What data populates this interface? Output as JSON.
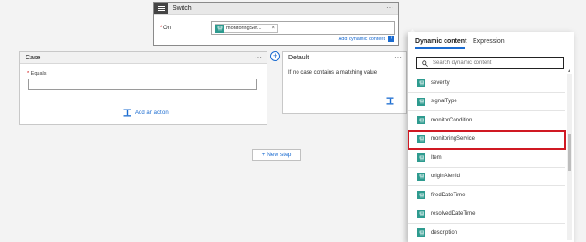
{
  "switch": {
    "title": "Switch",
    "menu": "···",
    "on_label": "On",
    "required_mark": "*",
    "token_label": "monitoringSer...",
    "token_remove": "×",
    "add_dynamic_label": "Add dynamic content",
    "add_dynamic_plus": "+"
  },
  "case": {
    "title": "Case",
    "menu": "···",
    "equals_label": "Equals",
    "required_mark": "*",
    "equals_value": "",
    "add_action_label": "Add an action"
  },
  "add_case": "+",
  "default": {
    "title": "Default",
    "menu": "···",
    "text": "If no case contains a matching value"
  },
  "new_step_label": "+ New step",
  "dynamic_panel": {
    "tabs": [
      "Dynamic content",
      "Expression"
    ],
    "active_tab": "Dynamic content",
    "search_placeholder": "Search dynamic content",
    "items": [
      {
        "label": "severity"
      },
      {
        "label": "signalType"
      },
      {
        "label": "monitorCondition"
      },
      {
        "label": "monitoringService"
      },
      {
        "label": "Item"
      },
      {
        "label": "originAlertId"
      },
      {
        "label": "firedDateTime"
      },
      {
        "label": "resolvedDateTime"
      },
      {
        "label": "description"
      }
    ],
    "highlighted_item": "monitoringService",
    "icon": "variable-icon",
    "accent_color": "#2e9b8f",
    "highlight_color": "#d01923"
  }
}
